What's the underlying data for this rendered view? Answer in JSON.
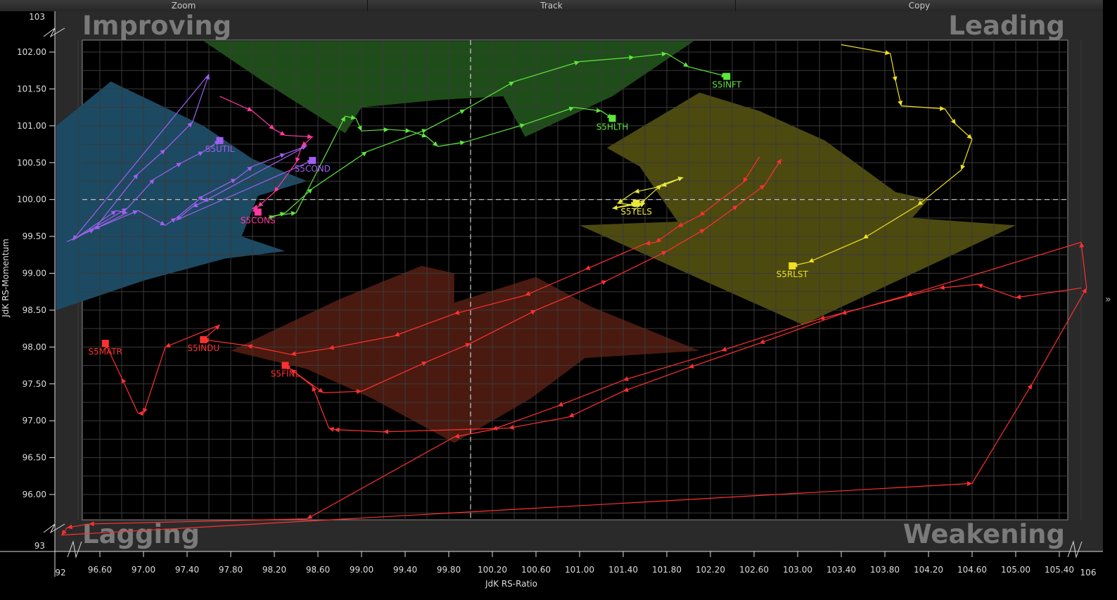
{
  "toolbar": {
    "zoom": "Zoom",
    "track": "Track",
    "copy": "Copy"
  },
  "quadrants": {
    "improving": "Improving",
    "leading": "Leading",
    "lagging": "Lagging",
    "weakening": "Weakening"
  },
  "colors": {
    "improving": "#1c4a63",
    "leading": "#1f4d1a",
    "lagging": "#4a1a10",
    "weakening": "#4d4a10",
    "grid": "#3a3a3a",
    "plot_bg": "#000000",
    "frame": "#2a2a2a"
  },
  "chart_data": {
    "type": "scatter",
    "xlabel": "JdK RS-Ratio",
    "ylabel": "JdK RS-Momentum",
    "xlim": [
      96.2,
      105.8
    ],
    "ylim": [
      95.7,
      102.2
    ],
    "x_ticks": [
      "96.60",
      "97.00",
      "97.40",
      "97.80",
      "98.20",
      "98.60",
      "99.00",
      "99.40",
      "99.80",
      "100.20",
      "100.60",
      "101.00",
      "101.40",
      "101.80",
      "102.20",
      "102.60",
      "103.00",
      "103.40",
      "103.80",
      "104.20",
      "104.60",
      "105.00",
      "105.40"
    ],
    "y_ticks": [
      "102.00",
      "101.50",
      "101.00",
      "100.50",
      "100.00",
      "99.50",
      "99.00",
      "98.50",
      "98.00",
      "97.50",
      "97.00",
      "96.50",
      "96.00"
    ],
    "axis_break_labels": {
      "x_min": "92",
      "x_max": "106",
      "y_max": "103",
      "y_min": "93"
    },
    "grid": true,
    "center_lines": {
      "x": 100,
      "y": 100
    },
    "series": [
      {
        "name": "S5INFT",
        "color": "#5fe63c",
        "points": [
          [
            98.15,
            99.75
          ],
          [
            98.3,
            99.82
          ],
          [
            98.55,
            100.15
          ],
          [
            99.05,
            100.65
          ],
          [
            99.6,
            100.95
          ],
          [
            99.95,
            101.22
          ],
          [
            100.4,
            101.6
          ],
          [
            101.0,
            101.87
          ],
          [
            101.5,
            101.93
          ],
          [
            101.8,
            101.98
          ],
          [
            102.0,
            101.8
          ],
          [
            102.35,
            101.67
          ]
        ]
      },
      {
        "name": "S5HLTH",
        "color": "#5fe63c",
        "points": [
          [
            98.15,
            99.75
          ],
          [
            98.2,
            99.78
          ],
          [
            98.4,
            99.82
          ],
          [
            98.85,
            101.13
          ],
          [
            98.95,
            101.1
          ],
          [
            99.0,
            100.93
          ],
          [
            99.25,
            100.95
          ],
          [
            99.45,
            100.93
          ],
          [
            99.6,
            100.85
          ],
          [
            99.7,
            100.72
          ],
          [
            99.95,
            100.78
          ],
          [
            100.5,
            101.02
          ],
          [
            100.95,
            101.25
          ],
          [
            101.2,
            101.2
          ],
          [
            101.3,
            101.1
          ]
        ]
      },
      {
        "name": "S5UTIL",
        "color": "#a060f0",
        "points": [
          [
            96.3,
            99.43
          ],
          [
            96.55,
            99.6
          ],
          [
            96.95,
            100.35
          ],
          [
            97.2,
            100.68
          ],
          [
            97.45,
            101.05
          ],
          [
            97.6,
            101.7
          ],
          [
            96.35,
            99.45
          ],
          [
            96.85,
            99.88
          ],
          [
            97.1,
            100.28
          ],
          [
            97.35,
            100.5
          ],
          [
            97.55,
            100.65
          ],
          [
            97.7,
            100.8
          ]
        ]
      },
      {
        "name": "S5COND",
        "color": "#a060f0",
        "points": [
          [
            96.35,
            99.45
          ],
          [
            96.75,
            99.85
          ],
          [
            96.85,
            99.82
          ],
          [
            96.55,
            99.6
          ],
          [
            96.95,
            99.85
          ],
          [
            97.2,
            99.65
          ],
          [
            97.3,
            99.75
          ],
          [
            97.55,
            100.05
          ],
          [
            97.85,
            100.28
          ],
          [
            98.0,
            100.45
          ],
          [
            98.3,
            100.62
          ],
          [
            98.5,
            100.73
          ],
          [
            97.55,
            99.97
          ],
          [
            97.45,
            99.9
          ],
          [
            97.3,
            99.72
          ],
          [
            98.55,
            100.53
          ]
        ]
      },
      {
        "name": "S5CONS",
        "color": "#ff3aa0",
        "points": [
          [
            97.7,
            101.4
          ],
          [
            98.0,
            101.2
          ],
          [
            98.2,
            100.95
          ],
          [
            98.3,
            100.87
          ],
          [
            98.55,
            100.85
          ],
          [
            98.45,
            100.72
          ],
          [
            98.4,
            100.5
          ],
          [
            98.2,
            100.1
          ],
          [
            98.05,
            99.9
          ],
          [
            98.0,
            99.88
          ],
          [
            98.05,
            99.83
          ]
        ]
      },
      {
        "name": "S5TELS",
        "color": "#e8e83c",
        "points": [
          [
            101.5,
            99.85
          ],
          [
            101.6,
            100.0
          ],
          [
            101.75,
            100.2
          ],
          [
            101.95,
            100.3
          ],
          [
            101.75,
            100.18
          ],
          [
            101.5,
            100.1
          ],
          [
            101.35,
            99.95
          ],
          [
            101.55,
            99.92
          ],
          [
            101.6,
            99.95
          ],
          [
            101.3,
            99.88
          ],
          [
            101.52,
            99.95
          ]
        ]
      },
      {
        "name": "S5RLST",
        "color": "#f0e020",
        "points": [
          [
            103.4,
            102.1
          ],
          [
            103.85,
            101.98
          ],
          [
            103.9,
            101.6
          ],
          [
            103.95,
            101.27
          ],
          [
            104.35,
            101.23
          ],
          [
            104.45,
            101.02
          ],
          [
            104.6,
            100.82
          ],
          [
            104.5,
            100.4
          ],
          [
            104.1,
            99.92
          ],
          [
            103.6,
            99.47
          ],
          [
            103.1,
            99.15
          ],
          [
            102.95,
            99.1
          ]
        ]
      },
      {
        "name": "S5MATR",
        "color": "#ff3030",
        "points": [
          [
            102.65,
            100.58
          ],
          [
            102.5,
            100.23
          ],
          [
            102.1,
            99.78
          ],
          [
            101.9,
            99.63
          ],
          [
            101.7,
            99.42
          ],
          [
            101.6,
            99.4
          ],
          [
            101.05,
            99.05
          ],
          [
            100.5,
            98.7
          ],
          [
            99.85,
            98.45
          ],
          [
            99.3,
            98.15
          ],
          [
            98.7,
            97.98
          ],
          [
            98.35,
            97.9
          ],
          [
            97.95,
            98.02
          ],
          [
            97.55,
            98.1
          ],
          [
            97.7,
            98.3
          ],
          [
            97.2,
            98.0
          ],
          [
            97.0,
            97.1
          ],
          [
            96.95,
            97.1
          ],
          [
            96.8,
            97.58
          ],
          [
            96.65,
            98.05
          ]
        ]
      },
      {
        "name": "S5INDU",
        "color": "#ff3030",
        "points": [
          [
            105.65,
            98.8
          ],
          [
            105.6,
            99.42
          ],
          [
            104.0,
            98.7
          ],
          [
            103.4,
            98.45
          ],
          [
            102.65,
            98.05
          ],
          [
            102.0,
            97.72
          ],
          [
            101.4,
            97.4
          ],
          [
            100.9,
            97.05
          ],
          [
            100.35,
            96.9
          ],
          [
            99.2,
            96.85
          ],
          [
            98.75,
            96.88
          ],
          [
            98.7,
            96.9
          ],
          [
            98.55,
            97.47
          ],
          [
            98.35,
            97.7
          ],
          [
            98.3,
            97.75
          ]
        ]
      },
      {
        "name": "S5FINL",
        "color": "#ff3030",
        "points": [
          [
            105.6,
            98.8
          ],
          [
            105.0,
            98.67
          ],
          [
            104.65,
            98.85
          ],
          [
            104.3,
            98.8
          ],
          [
            103.2,
            98.38
          ],
          [
            102.3,
            97.95
          ],
          [
            101.4,
            97.55
          ],
          [
            100.8,
            97.2
          ],
          [
            100.2,
            96.88
          ],
          [
            99.85,
            96.78
          ],
          [
            98.5,
            95.67
          ],
          [
            96.5,
            95.6
          ],
          [
            96.3,
            95.55
          ],
          [
            96.25,
            95.45
          ],
          [
            104.6,
            96.15
          ],
          [
            105.15,
            97.5
          ],
          [
            105.65,
            98.8
          ]
        ]
      },
      {
        "name": "S5FINL",
        "color": "#ff3030",
        "points": [
          [
            98.3,
            97.75
          ],
          [
            98.65,
            97.38
          ],
          [
            99.0,
            97.4
          ],
          [
            99.6,
            97.8
          ],
          [
            100.0,
            98.05
          ],
          [
            100.6,
            98.5
          ],
          [
            101.25,
            98.9
          ],
          [
            101.8,
            99.3
          ],
          [
            102.15,
            99.6
          ],
          [
            102.45,
            99.92
          ],
          [
            102.7,
            100.2
          ],
          [
            102.85,
            100.55
          ]
        ]
      }
    ],
    "labels": [
      {
        "text": "S5INFT",
        "x": 102.35,
        "y": 101.67,
        "color": "#5fe63c"
      },
      {
        "text": "S5HLTH",
        "x": 101.3,
        "y": 101.1,
        "color": "#5fe63c"
      },
      {
        "text": "S5UTIL",
        "x": 97.7,
        "y": 100.8,
        "color": "#a060f0"
      },
      {
        "text": "S5COND",
        "x": 98.55,
        "y": 100.53,
        "color": "#a060f0"
      },
      {
        "text": "S5CONS",
        "x": 98.05,
        "y": 99.83,
        "color": "#ff3aa0"
      },
      {
        "text": "S5TELS",
        "x": 101.52,
        "y": 99.95,
        "color": "#e8e83c"
      },
      {
        "text": "S5RLST",
        "x": 102.95,
        "y": 99.1,
        "color": "#f0e020"
      },
      {
        "text": "S5MATR",
        "x": 96.65,
        "y": 98.05,
        "color": "#ff3030"
      },
      {
        "text": "S5INDU",
        "x": 97.55,
        "y": 98.1,
        "color": "#ff3030"
      },
      {
        "text": "S5FINL",
        "x": 98.3,
        "y": 97.75,
        "color": "#ff3030"
      }
    ]
  }
}
